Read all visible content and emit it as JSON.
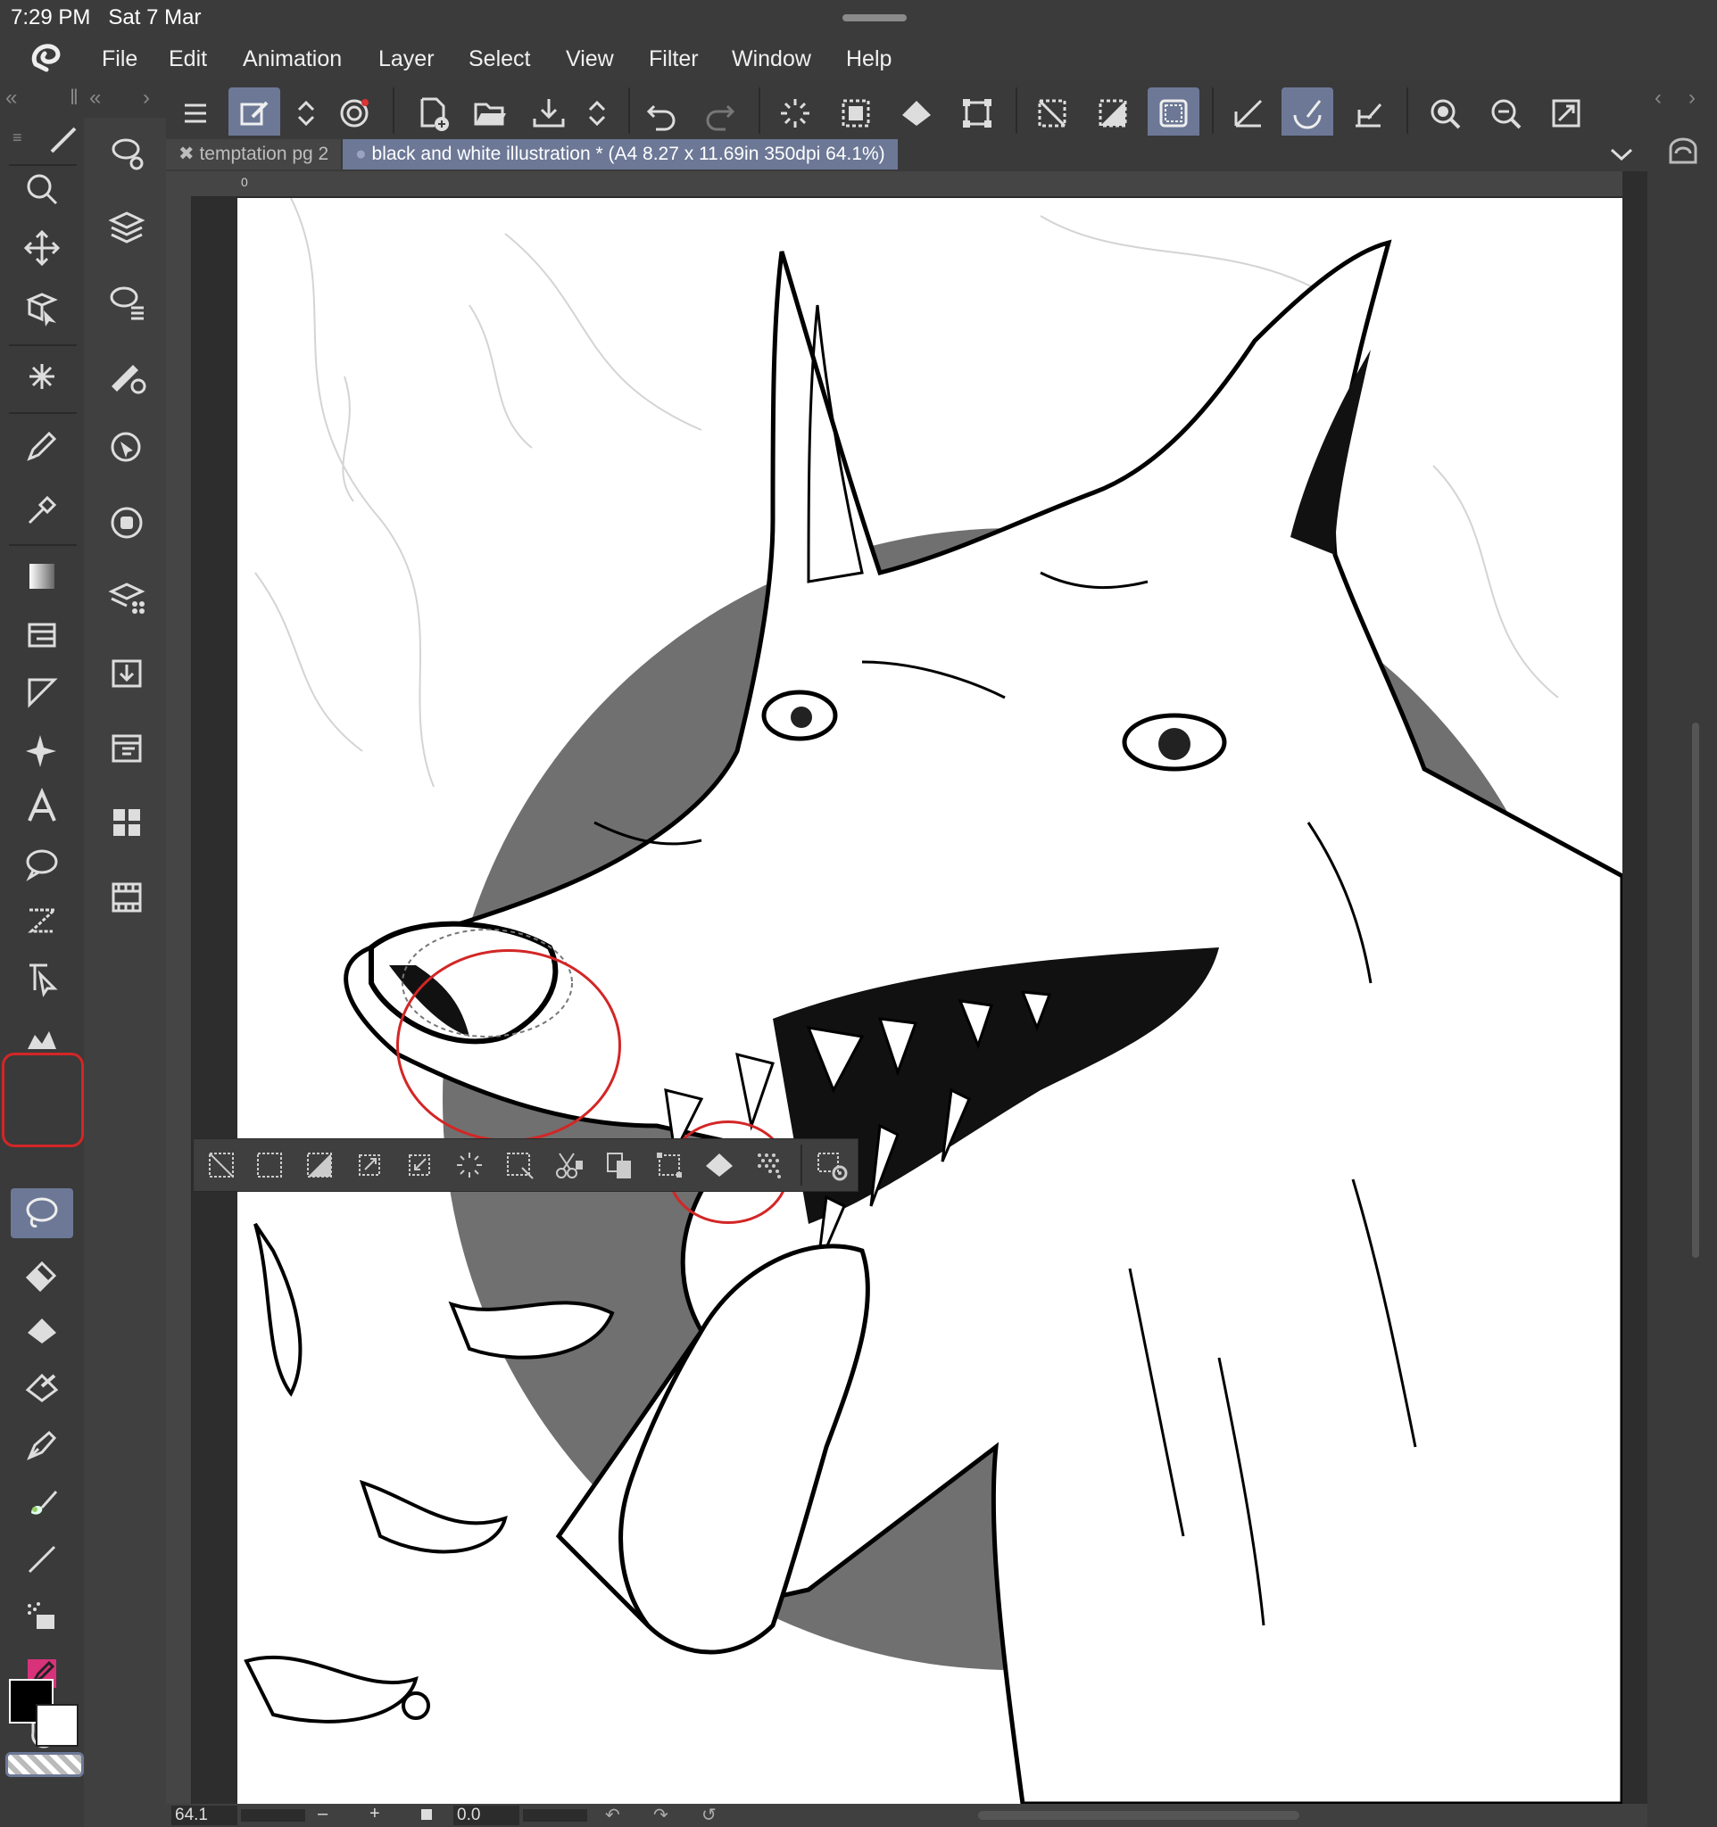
{
  "status_bar": {
    "time": "7:29 PM",
    "date": "Sat 7 Mar"
  },
  "menu": {
    "items": [
      "File",
      "Edit",
      "Animation",
      "Layer",
      "Select",
      "View",
      "Filter",
      "Window",
      "Help"
    ]
  },
  "tabs": [
    {
      "label": "temptation pg 2",
      "active": false
    },
    {
      "label": "black and white illustration * (A4 8.27 x 11.69in 350dpi 64.1%)",
      "active": true
    }
  ],
  "ruler": {
    "origin_label": "0"
  },
  "command_bar": {
    "icons": [
      "menu-icon",
      "edit-mode-icon",
      "updown-arrows-icon",
      "record-icon",
      "new-file-icon",
      "open-file-icon",
      "save-icon",
      "updown-arrows-icon",
      "undo-icon",
      "redo-icon",
      "loading-icon",
      "select-all-icon",
      "fill-icon",
      "transform-icon",
      "deselect-icon",
      "invert-selection-icon",
      "selection-border-icon",
      "ruler-snap-icon",
      "special-ruler-snap-icon",
      "grid-snap-icon",
      "zoom-in-icon",
      "zoom-out-icon",
      "fit-screen-icon"
    ],
    "active": [
      "edit-mode-icon",
      "selection-border-icon",
      "special-ruler-snap-icon"
    ]
  },
  "tools": {
    "icons": [
      "zoom-icon",
      "move-icon",
      "object-icon",
      "auto-select-icon",
      "pen-icon",
      "eyedropper-icon",
      "gradient-icon",
      "frame-icon",
      "ruler-icon",
      "sparkle-icon",
      "text-icon",
      "balloon-icon",
      "line-icon",
      "vector-select-icon",
      "fill-shape-icon",
      "lasso-fill-icon",
      "eraser-icon",
      "fill-bucket-icon",
      "gradient-bucket-icon",
      "pen-nib-icon",
      "brush-icon",
      "straight-line-icon",
      "airbrush-icon",
      "decoration-icon",
      "hand-icon"
    ],
    "active": "lasso-fill-icon"
  },
  "sub_panel": {
    "icons": [
      "sub-tool-icon",
      "layers-icon",
      "layer-property-icon",
      "brush-size-icon",
      "navigator-icon",
      "color-wheel-icon",
      "material-icon",
      "import-icon",
      "layer-search-icon",
      "color-set-icon",
      "timeline-icon"
    ]
  },
  "colors": {
    "main": "#000000",
    "sub": "#ffffff",
    "accent": "#6c7896",
    "annotation": "#d32626"
  },
  "launcher": {
    "icons": [
      "deselect-icon",
      "select-all-icon",
      "invert-icon",
      "expand-icon",
      "shrink-icon",
      "loading-icon",
      "select-layer-icon",
      "cut-paste-icon",
      "copy-paste-icon",
      "transform-icon",
      "fill-icon",
      "tone-icon",
      "settings-icon"
    ]
  },
  "bottom": {
    "zoom": "64.1",
    "minus": "–",
    "plus": "+",
    "angle": "0.0"
  }
}
